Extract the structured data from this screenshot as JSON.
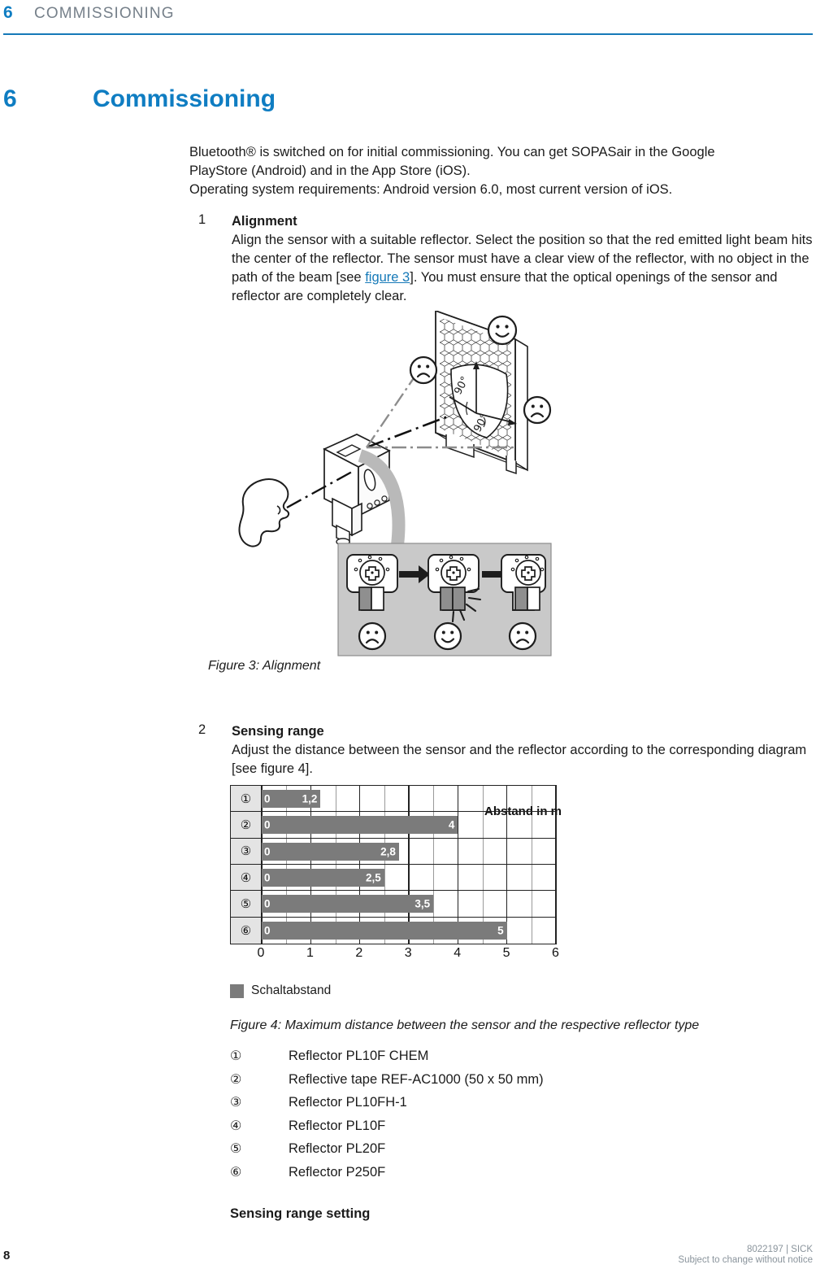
{
  "header": {
    "chapter_number": "6",
    "chapter_title_running": "COMMISSIONING",
    "rule_color": "#1579b8",
    "accent_color": "#0f7dc2"
  },
  "chapter": {
    "number": "6",
    "title": "Commissioning"
  },
  "intro": {
    "line1": "Bluetooth® is switched on for initial commissioning. You can get SOPASair in the Google",
    "line2": "PlayStore (Android) and in the App Store (iOS).",
    "line3": "Operating system requirements: Android version 6.0, most current version of iOS."
  },
  "steps": [
    {
      "number": "1",
      "title": "Alignment",
      "text_before_xref": "Align the sensor with a suitable reflector. Select the position so that the red emitted light beam hits the center of the reflector. The sensor must have a clear view of the reflector, with no object in the path of the beam [see ",
      "xref": "figure 3",
      "text_after_xref": "]. You must ensure that the optical openings of the sensor and reflector are completely clear."
    },
    {
      "number": "2",
      "title": "Sensing range",
      "text": "Adjust the distance between the sensor and the reflector according to the corresponding diagram [see figure 4]."
    }
  ],
  "figure3": {
    "caption": "Figure 3: Alignment",
    "angle_label_vertical": "90°",
    "angle_label_horizontal": "90°",
    "face_good": "☺",
    "face_bad": "☹"
  },
  "figure4": {
    "caption": "Figure 4: Maximum distance between the sensor and the respective reflector type",
    "legend_label": "Schaltabstand",
    "legend_color": "#7b7b7b",
    "key": [
      {
        "marker": "①",
        "label": "Reflector PL10F CHEM"
      },
      {
        "marker": "②",
        "label": "Reflective tape REF-AC1000 (50 x 50 mm)"
      },
      {
        "marker": "③",
        "label": "Reflector PL10FH-1"
      },
      {
        "marker": "④",
        "label": "Reflector PL10F"
      },
      {
        "marker": "⑤",
        "label": "Reflector PL20F"
      },
      {
        "marker": "⑥",
        "label": "Reflector P250F"
      }
    ]
  },
  "chart_data": {
    "type": "bar",
    "orientation": "horizontal",
    "title": "Figure 4: Maximum distance between the sensor and the respective reflector type",
    "xlabel": "Abstand in m",
    "ylabel": "",
    "xlim": [
      0,
      6
    ],
    "xticks": [
      0,
      1,
      2,
      3,
      4,
      5,
      6
    ],
    "xticklabels": [
      "0",
      "1",
      "2",
      "3",
      "4",
      "5",
      "6"
    ],
    "minor_tick_step": 0.5,
    "grid": true,
    "legend": [
      "Schaltabstand"
    ],
    "legend_position": "below",
    "bar_color": "#7b7b7b",
    "categories": [
      "①",
      "②",
      "③",
      "④",
      "⑤",
      "⑥"
    ],
    "category_labels": [
      "Reflector PL10F CHEM",
      "Reflective tape REF-AC1000 (50 x 50 mm)",
      "Reflector PL10FH-1",
      "Reflector PL10F",
      "Reflector PL20F",
      "Reflector P250F"
    ],
    "values": [
      1.2,
      4,
      2.8,
      2.5,
      3.5,
      5
    ],
    "start_labels": [
      "0",
      "0",
      "0",
      "0",
      "0",
      "0"
    ],
    "end_labels": [
      "1,2",
      "4",
      "2,8",
      "2,5",
      "3,5",
      "5"
    ]
  },
  "trailing": {
    "heading": "Sensing range setting"
  },
  "footer": {
    "page_number": "8",
    "doc_number": "8022197 | SICK",
    "disclaimer": "Subject to change without notice"
  }
}
